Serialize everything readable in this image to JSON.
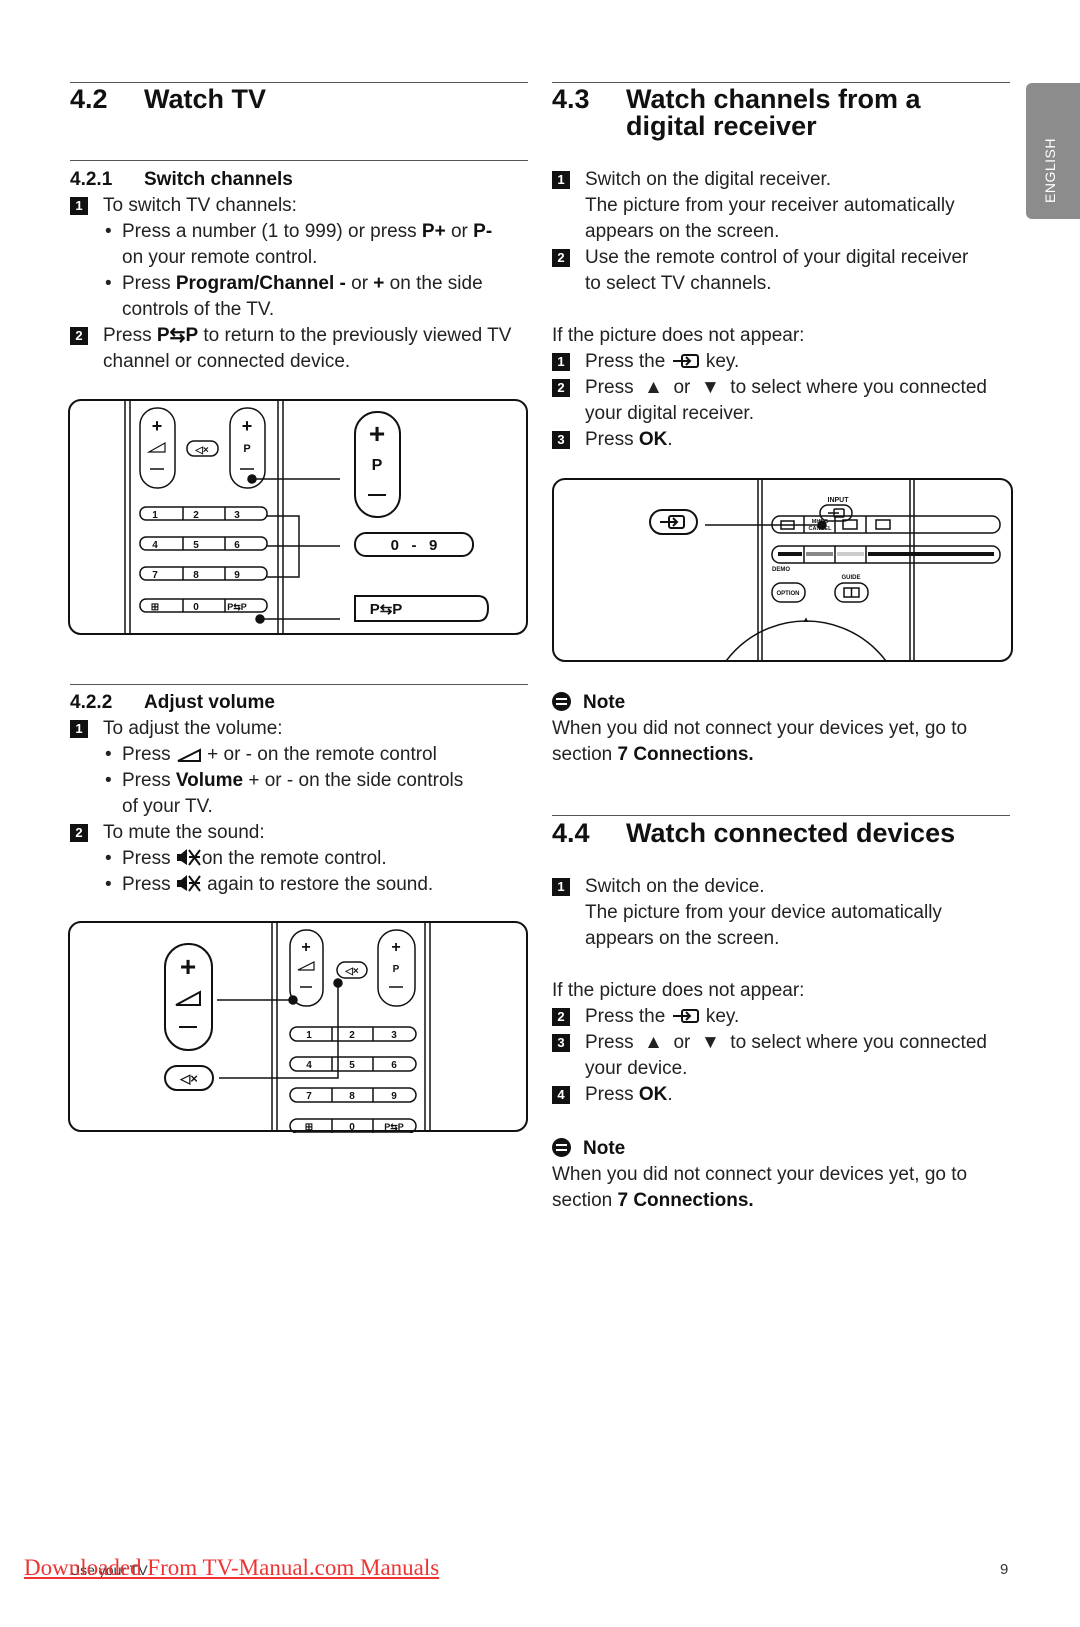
{
  "side_tab": "ENGLISH",
  "left": {
    "s42": {
      "num": "4.2",
      "title": "Watch TV"
    },
    "s421": {
      "num": "4.2.1",
      "title": "Switch channels",
      "l1": "To switch TV channels:",
      "l2a": "Press a number (1 to 999) or press ",
      "l2b": "P+",
      "l2c": " or ",
      "l2d": "P-",
      "l3": "on your remote control.",
      "l4a": "Press ",
      "l4b": "Program/Channel -",
      "l4c": " or ",
      "l4d": "+",
      "l4e": " on the side",
      "l5": "controls of the TV.",
      "l6a": "Press ",
      "l6b": "P⇆P",
      "l6c": " to return to the previously viewed TV",
      "l7": "channel or connected device."
    },
    "diagram1": {
      "digits": [
        "1",
        "2",
        "3",
        "4",
        "5",
        "6",
        "7",
        "8",
        "9",
        "0"
      ],
      "p": "P",
      "range": "0   -   9",
      "pp": "P⇆P"
    },
    "s422": {
      "num": "4.2.2",
      "title": "Adjust volume",
      "l1": "To adjust the volume:",
      "l2a": "Press ",
      "l2b": " + or - on the remote control",
      "l3a": "Press ",
      "l3b": "Volume",
      "l3c": " + or - on the side controls",
      "l4": "of your TV.",
      "l5": "To mute the sound:",
      "l6a": "Press ",
      "l6b": "on the remote control.",
      "l7a": "Press ",
      "l7b": " again to restore the sound."
    },
    "diagram2": {
      "digits": [
        "1",
        "2",
        "3",
        "4",
        "5",
        "6",
        "7",
        "8",
        "9",
        "0"
      ],
      "p": "P",
      "pp": "P⇆P"
    }
  },
  "right": {
    "s43": {
      "num": "4.3",
      "title1": "Watch channels from a",
      "title2": "digital receiver",
      "l1": "Switch on the digital receiver.",
      "l2": "The picture from your receiver automatically",
      "l3": "appears on the screen.",
      "l4": "Use the remote control of your digital receiver",
      "l5": "to select TV channels.",
      "l6": "If the picture does not appear:",
      "l7a": "Press the ",
      "l7b": " key.",
      "l8a": "Press  ▲  or  ▼  to select where you connected",
      "l9": "your digital receiver.",
      "l10a": "Press ",
      "l10b": "OK",
      "l10c": "."
    },
    "diagram3": {
      "input": "INPUT",
      "mheg1": "MHEG",
      "mheg2": "CANCEL",
      "demo": "DEMO",
      "guide": "GUIDE",
      "option": "OPTION",
      "up": "▲",
      "bar_colors": [
        "#111111",
        "#888888",
        "#cccccc",
        "#111111"
      ]
    },
    "note1": {
      "title": "Note",
      "l1": "When you did not connect your devices yet, go to",
      "l2a": "section ",
      "l2b": "7 Connections."
    },
    "s44": {
      "num": "4.4",
      "title": "Watch connected devices",
      "l1": "Switch on the device.",
      "l2": "The picture from your device automatically",
      "l3": "appears on the screen.",
      "l4": "If the picture does not appear:",
      "l5a": "Press the ",
      "l5b": " key.",
      "l6": "Press  ▲  or  ▼  to select where you connected",
      "l7": "your device.",
      "l8a": "Press ",
      "l8b": "OK",
      "l8c": "."
    },
    "note2": {
      "title": "Note",
      "l1": "When you did not connect your devices yet, go to",
      "l2a": "section ",
      "l2b": "7 Connections."
    }
  },
  "steps": [
    "1",
    "2",
    "3",
    "4"
  ],
  "footer": {
    "watermark": "Downloaded From TV-Manual.com Manuals",
    "section": "Use your TV",
    "page": "9"
  }
}
